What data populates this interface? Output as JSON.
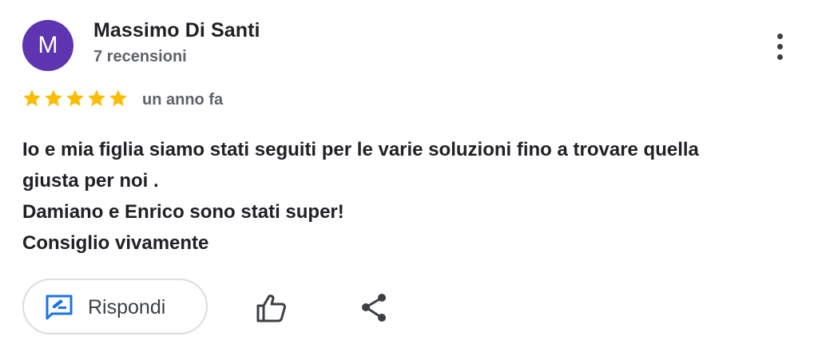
{
  "author": {
    "initial": "M",
    "name": "Massimo Di Santi",
    "review_count": "7 recensioni",
    "avatar_color": "#5e35b1"
  },
  "rating": {
    "stars": 5,
    "max_stars": 5,
    "star_color": "#fbbc04",
    "time_ago": "un anno fa"
  },
  "review": {
    "lines": [
      "Io e mia figlia siamo stati seguiti per le varie soluzioni fino a trovare quella",
      "giusta per noi .",
      "Damiano e Enrico sono stati super!",
      "Consiglio vivamente"
    ]
  },
  "actions": {
    "reply_label": "Rispondi",
    "reply_icon": "reply-icon",
    "like_icon": "thumb-up-icon",
    "share_icon": "share-icon",
    "more_icon": "more-vertical-icon",
    "accent_color": "#1a73e8"
  }
}
